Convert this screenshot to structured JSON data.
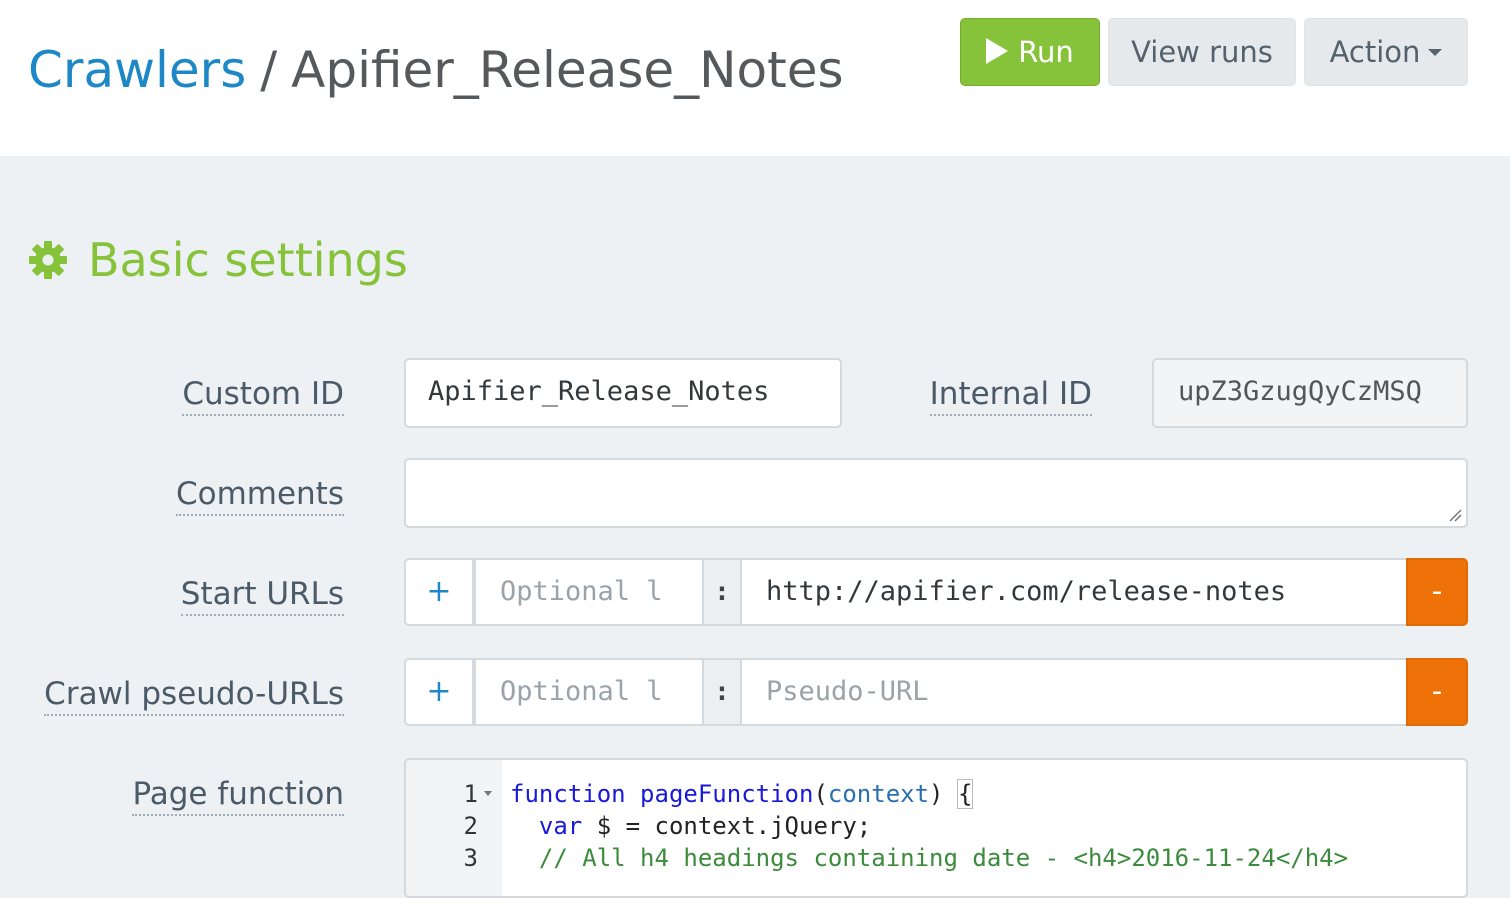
{
  "header": {
    "crumb_link": "Crawlers",
    "crumb_separator": "/",
    "crumb_current": "Apifier_Release_Notes"
  },
  "toolbar": {
    "run_label": "Run",
    "view_runs_label": "View runs",
    "action_label": "Action"
  },
  "section": {
    "title": "Basic settings",
    "icon": "gear-icon"
  },
  "form": {
    "custom_id_label": "Custom ID",
    "custom_id_value": "Apifier_Release_Notes",
    "internal_id_label": "Internal ID",
    "internal_id_value": "upZ3GzugQyCzMSQ",
    "comments_label": "Comments",
    "comments_value": "",
    "start_urls_label": "Start URLs",
    "start_urls": [
      {
        "plus": "+",
        "label_placeholder": "Optional l",
        "colon": ":",
        "url": "http://apifier.com/release-notes",
        "minus": "-"
      }
    ],
    "pseudo_urls_label": "Crawl pseudo-URLs",
    "pseudo_urls": [
      {
        "plus": "+",
        "label_placeholder": "Optional l",
        "colon": ":",
        "url_placeholder": "Pseudo-URL",
        "minus": "-"
      }
    ],
    "page_function_label": "Page function"
  },
  "editor": {
    "line_numbers": [
      "1",
      "2",
      "3"
    ],
    "line1": {
      "kw": "function",
      "name": "pageFunction",
      "open": "(",
      "param": "context",
      "close": ") ",
      "brace": "{"
    },
    "line2": {
      "kw": "var",
      "rest": " $ = context.jQuery;"
    },
    "line3": {
      "comment": "// All h4 headings containing date - <h4>2016-11-24</h4>"
    }
  },
  "colors": {
    "accent_blue": "#1e88c7",
    "run_green": "#86c33b",
    "remove_orange": "#ee7208",
    "page_bg": "#eef1f3"
  }
}
